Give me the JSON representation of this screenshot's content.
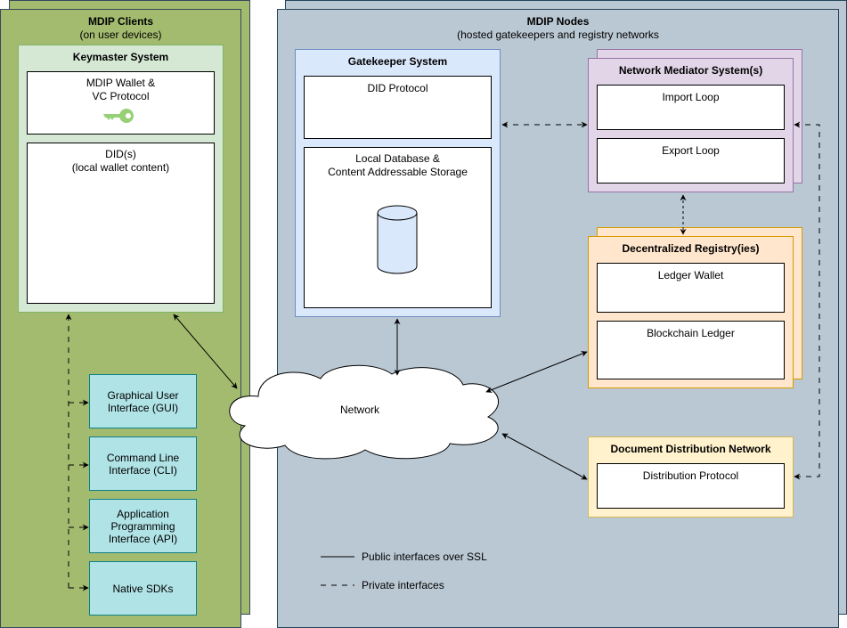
{
  "clients": {
    "title": "MDIP Clients",
    "subtitle": "(on user devices)",
    "keymaster": {
      "title": "Keymaster System",
      "wallet": "MDIP Wallet &\nVC Protocol",
      "dids": "DID(s)\n(local wallet content)"
    },
    "interfaces": [
      "Graphical User Interface (GUI)",
      "Command Line Interface (CLI)",
      "Application Programming Interface (API)",
      "Native SDKs"
    ]
  },
  "nodes": {
    "title": "MDIP Nodes",
    "subtitle": "(hosted gatekeepers and registry networks",
    "gatekeeper": {
      "title": "Gatekeeper System",
      "did_protocol": "DID Protocol",
      "storage": "Local Database &\nContent Addressable Storage"
    },
    "mediator": {
      "title": "Network Mediator System(s)",
      "import": "Import Loop",
      "export": "Export Loop"
    },
    "registry": {
      "title": "Decentralized Registry(ies)",
      "wallet": "Ledger Wallet",
      "ledger": "Blockchain Ledger"
    },
    "distribution": {
      "title": "Document Distribution Network",
      "protocol": "Distribution Protocol"
    }
  },
  "network": "Network",
  "legend": {
    "public": "Public interfaces over SSL",
    "private": "Private interfaces"
  },
  "colors": {
    "clients": "#a3bb6f",
    "keymaster": "#d5e8d4",
    "interfaces": "#b0e3e6",
    "nodes": "#bac8d3",
    "gatekeeper": "#dae8fc",
    "mediator": "#e1d5e7",
    "registry": "#ffe6cc",
    "distribution": "#fff2cc",
    "key": "#97d077"
  }
}
